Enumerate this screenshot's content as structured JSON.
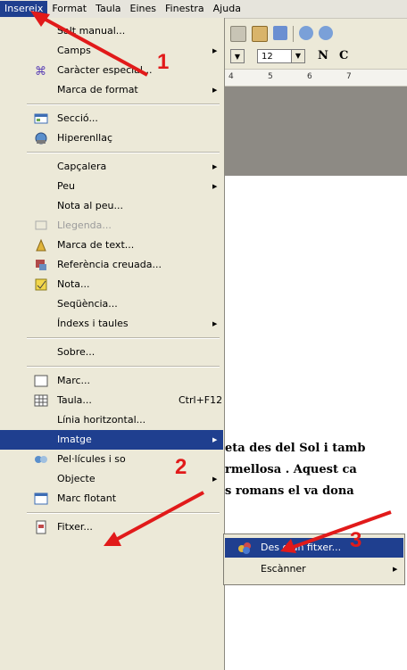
{
  "menubar": {
    "items": [
      "Insereix",
      "Format",
      "Taula",
      "Eines",
      "Finestra",
      "Ajuda"
    ]
  },
  "toolbar": {
    "font_size": "12",
    "bold_label": "N",
    "italic_label": "C"
  },
  "ruler": {
    "marks": [
      "4",
      "5",
      "6",
      "7"
    ]
  },
  "menu": {
    "items": [
      {
        "label": "Salt manual...",
        "icon": "none"
      },
      {
        "label": "Camps",
        "submenu": true
      },
      {
        "label": "Caràcter especial...",
        "icon": "omega-icon"
      },
      {
        "label": "Marca de format",
        "submenu": true
      },
      {
        "label": "Secció...",
        "icon": "section-icon"
      },
      {
        "label": "Hiperenllaç",
        "icon": "hyperlink-icon"
      },
      {
        "label": "Capçalera",
        "submenu": true
      },
      {
        "label": "Peu",
        "submenu": true
      },
      {
        "label": "Nota al peu..."
      },
      {
        "label": "Llegenda...",
        "disabled": true,
        "icon": "caption-icon"
      },
      {
        "label": "Marca de text...",
        "icon": "bookmark-icon"
      },
      {
        "label": "Referència creuada...",
        "icon": "crossref-icon"
      },
      {
        "label": "Nota...",
        "icon": "note-icon"
      },
      {
        "label": "Seqüència..."
      },
      {
        "label": "Índexs i taules",
        "submenu": true
      },
      {
        "label": "Sobre..."
      },
      {
        "label": "Marc...",
        "icon": "frame-icon"
      },
      {
        "label": "Taula...",
        "shortcut": "Ctrl+F12",
        "icon": "table-icon"
      },
      {
        "label": "Línia horitzontal..."
      },
      {
        "label": "Imatge",
        "submenu": true,
        "highlighted": true
      },
      {
        "label": "Pel·lícules i so",
        "icon": "movie-icon"
      },
      {
        "label": "Objecte",
        "submenu": true
      },
      {
        "label": "Marc flotant",
        "icon": "floating-frame-icon"
      },
      {
        "label": "Fitxer...",
        "icon": "file-icon"
      }
    ]
  },
  "submenu": {
    "items": [
      {
        "label": "Des d'un fitxer...",
        "icon": "image-file-icon",
        "highlighted": true
      },
      {
        "label": "Escànner",
        "submenu": true
      }
    ]
  },
  "document": {
    "lines": [
      "eta des del Sol i tamb",
      "rmellosa . Aquest ca",
      "s romans el va dona"
    ]
  },
  "annotations": {
    "step1": "1",
    "step2": "2",
    "step3": "3"
  },
  "colors": {
    "highlight": "#1f3f8f",
    "menu_bg": "#ece9d8",
    "annotation": "#e11a1a"
  }
}
